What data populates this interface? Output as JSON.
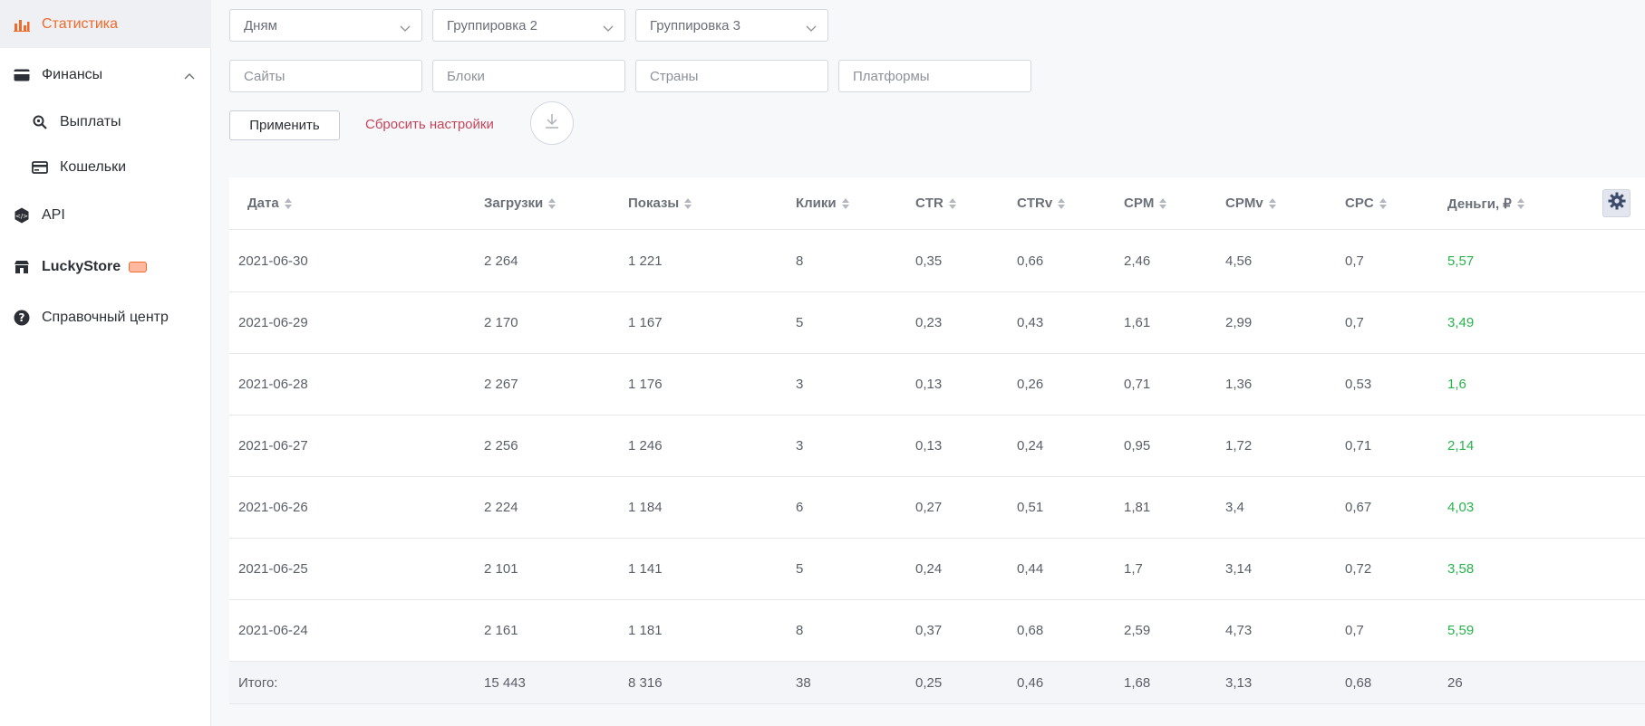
{
  "sidebar": {
    "statistics": "Статистика",
    "finance": "Финансы",
    "payouts": "Выплаты",
    "wallets": "Кошельки",
    "api": "API",
    "luckystore": "LuckyStore",
    "help_center": "Справочный центр"
  },
  "filters": {
    "group1": "Дням",
    "group2": "Группировка 2",
    "group3": "Группировка 3",
    "sites_placeholder": "Сайты",
    "blocks_placeholder": "Блоки",
    "countries_placeholder": "Страны",
    "platforms_placeholder": "Платформы",
    "apply_label": "Применить",
    "reset_label": "Сбросить настройки"
  },
  "table": {
    "headers": [
      "Дата",
      "Загрузки",
      "Показы",
      "Клики",
      "CTR",
      "CTRv",
      "CPM",
      "CPMv",
      "CPC",
      "Деньги, ₽"
    ],
    "rows": [
      [
        "2021-06-30",
        "2 264",
        "1 221",
        "8",
        "0,35",
        "0,66",
        "2,46",
        "4,56",
        "0,7",
        "5,57"
      ],
      [
        "2021-06-29",
        "2 170",
        "1 167",
        "5",
        "0,23",
        "0,43",
        "1,61",
        "2,99",
        "0,7",
        "3,49"
      ],
      [
        "2021-06-28",
        "2 267",
        "1 176",
        "3",
        "0,13",
        "0,26",
        "0,71",
        "1,36",
        "0,53",
        "1,6"
      ],
      [
        "2021-06-27",
        "2 256",
        "1 246",
        "3",
        "0,13",
        "0,24",
        "0,95",
        "1,72",
        "0,71",
        "2,14"
      ],
      [
        "2021-06-26",
        "2 224",
        "1 184",
        "6",
        "0,27",
        "0,51",
        "1,81",
        "3,4",
        "0,67",
        "4,03"
      ],
      [
        "2021-06-25",
        "2 101",
        "1 141",
        "5",
        "0,24",
        "0,44",
        "1,7",
        "3,14",
        "0,72",
        "3,58"
      ],
      [
        "2021-06-24",
        "2 161",
        "1 181",
        "8",
        "0,37",
        "0,68",
        "2,59",
        "4,73",
        "0,7",
        "5,59"
      ]
    ],
    "total": [
      "Итого:",
      "15 443",
      "8 316",
      "38",
      "0,25",
      "0,46",
      "1,68",
      "3,13",
      "0,68",
      "26"
    ]
  },
  "colors": {
    "accent": "#ef6b2c",
    "money": "#27b34c",
    "reset_link": "#c9445a"
  },
  "icons": {
    "statistics": "bar-chart-icon",
    "finance": "card-icon",
    "payouts": "magnifier-coin-icon",
    "wallets": "wallet-card-icon",
    "api": "api-hex-icon",
    "luckystore": "store-icon",
    "help": "question-circle-icon",
    "download": "download-icon",
    "settings": "gear-icon"
  }
}
